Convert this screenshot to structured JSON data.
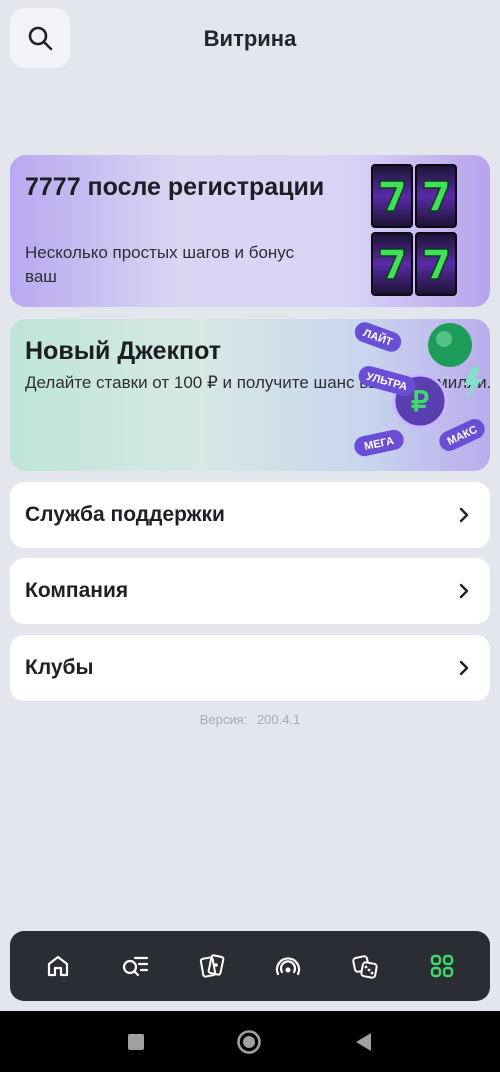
{
  "header": {
    "title": "Витрина",
    "search_icon": "search-icon"
  },
  "banners": [
    {
      "title": "7777 после регистрации",
      "text": "Несколько простых шагов и бонус ваш",
      "art": "slot-sevens"
    },
    {
      "title": "Новый Джекпот",
      "text": "Делайте ставки от 100 ₽ и получите шанс выиграть милли...",
      "art": "jackpot-chips",
      "chips": [
        "ЛАЙТ",
        "УЛЬТРА",
        "МЕГА",
        "МАКС"
      ]
    }
  ],
  "menu": [
    {
      "label": "Служба поддержки"
    },
    {
      "label": "Компания"
    },
    {
      "label": "Клубы"
    }
  ],
  "version": {
    "label": "Версия:",
    "value": "200.4.1"
  },
  "nav": [
    {
      "icon": "home-icon"
    },
    {
      "icon": "search-list-icon"
    },
    {
      "icon": "cards-icon"
    },
    {
      "icon": "live-icon"
    },
    {
      "icon": "dice-icon"
    },
    {
      "icon": "grid-icon",
      "active": true
    }
  ],
  "colors": {
    "background": "#e3e6ed",
    "nav_background": "#2a2d33",
    "accent_green": "#3ddc6a"
  }
}
